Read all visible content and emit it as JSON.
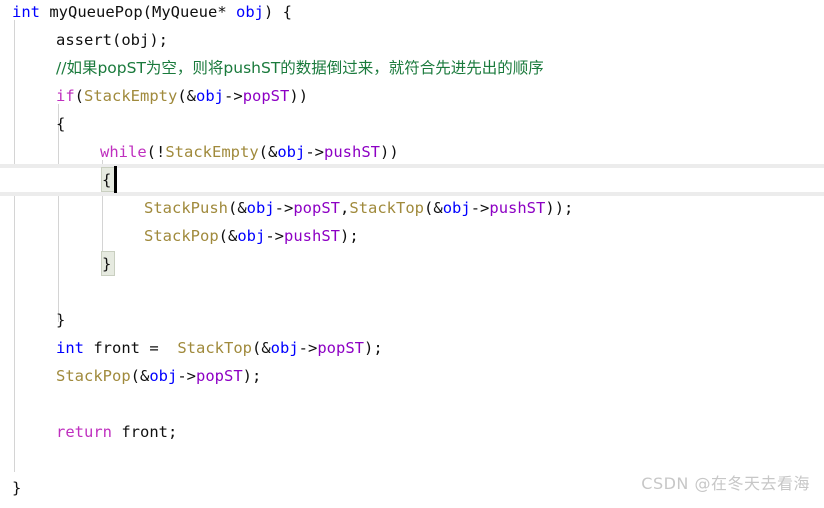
{
  "editor": {
    "language": "C",
    "background_color": "#ffffff",
    "font_size_px": 15.5,
    "line_height_px": 28,
    "colors": {
      "keyword": "#bf2fbf",
      "type": "#0000ff",
      "variable": "#0000ff",
      "function": "#a08a3c",
      "member": "#8d00c4",
      "comment": "#1a7a3c",
      "plain": "#101010",
      "indent_guide": "#d4d4d4",
      "current_line_border": "#ececec",
      "brace_match_fill": "#e6eae0",
      "brace_match_border": "#c9cfc0",
      "caret": "#000000",
      "watermark": "#c7c7c7"
    },
    "caret": {
      "line_index": 6,
      "column": 9,
      "visible": true
    },
    "current_line_index": 6,
    "brace_match_pair": [
      "{",
      "}"
    ]
  },
  "code": {
    "lines": [
      {
        "indent": 0,
        "text": "int myQueuePop(MyQueue* obj) {"
      },
      {
        "indent": 1,
        "text": "assert(obj);"
      },
      {
        "indent": 1,
        "text": "//如果popST为空，则将pushST的数据倒过来，就符合先进先出的顺序"
      },
      {
        "indent": 1,
        "text": "if(StackEmpty(&obj->popST))"
      },
      {
        "indent": 1,
        "text": "{"
      },
      {
        "indent": 2,
        "text": "while(!StackEmpty(&obj->pushST))"
      },
      {
        "indent": 2,
        "text": "{"
      },
      {
        "indent": 3,
        "text": "StackPush(&obj->popST,StackTop(&obj->pushST));"
      },
      {
        "indent": 3,
        "text": "StackPop(&obj->pushST);"
      },
      {
        "indent": 2,
        "text": "}"
      },
      {
        "indent": 0,
        "text": ""
      },
      {
        "indent": 1,
        "text": "}"
      },
      {
        "indent": 1,
        "text": "int front =  StackTop(&obj->popST);"
      },
      {
        "indent": 1,
        "text": "StackPop(&obj->popST);"
      },
      {
        "indent": 0,
        "text": ""
      },
      {
        "indent": 1,
        "text": "return front;"
      },
      {
        "indent": 0,
        "text": ""
      },
      {
        "indent": 0,
        "text": "}"
      }
    ],
    "tokens": {
      "l0": [
        "int",
        " ",
        "myQueuePop",
        "(",
        "MyQueue",
        "*",
        " ",
        "obj",
        ") {"
      ],
      "l1": [
        "assert",
        "(",
        "obj",
        ");"
      ],
      "l2_comment": "//如果popST为空，则将pushST的数据倒过来，就符合先进先出的顺序",
      "l3": [
        "if",
        "(",
        "StackEmpty",
        "(&",
        "obj",
        "->",
        "popST",
        "))"
      ],
      "l4": [
        "{"
      ],
      "l5": [
        "while",
        "(!",
        "StackEmpty",
        "(&",
        "obj",
        "->",
        "pushST",
        "))"
      ],
      "l6": [
        "{"
      ],
      "l7": [
        "StackPush",
        "(&",
        "obj",
        "->",
        "popST",
        ",",
        "StackTop",
        "(&",
        "obj",
        "->",
        "pushST",
        "));"
      ],
      "l8": [
        "StackPop",
        "(&",
        "obj",
        "->",
        "pushST",
        ");"
      ],
      "l9": [
        "}"
      ],
      "l11": [
        "}"
      ],
      "l12": [
        "int",
        " front =  ",
        "StackTop",
        "(&",
        "obj",
        "->",
        "popST",
        ");"
      ],
      "l13": [
        "StackPop",
        "(&",
        "obj",
        "->",
        "popST",
        ");"
      ],
      "l15": [
        "return",
        " front;"
      ],
      "l17": [
        "}"
      ]
    }
  },
  "watermark": {
    "text": "CSDN @在冬天去看海"
  }
}
